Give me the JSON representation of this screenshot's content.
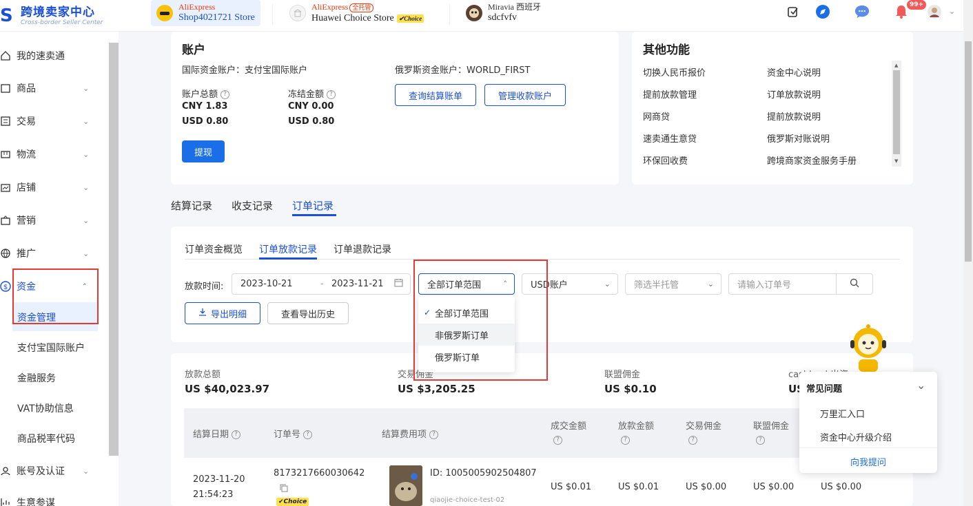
{
  "header": {
    "brand_title": "跨境卖家中心",
    "brand_sub": "Cross-border Seller Center",
    "stores": [
      {
        "platform": "AliExpress",
        "tag": "",
        "shop": "Shop4021721 Store"
      },
      {
        "platform": "AliExpress",
        "tag": "全托管",
        "shop": "Huawei Choice Store",
        "badge": "Choice"
      },
      {
        "platform": "Miravia 西班牙",
        "tag": "",
        "shop": "sdcfvfv"
      }
    ],
    "notification_count": "99+"
  },
  "sidebar": {
    "items": [
      {
        "label": "我的速卖通",
        "icon": "home-icon"
      },
      {
        "label": "商品",
        "icon": "product-icon"
      },
      {
        "label": "交易",
        "icon": "trade-icon"
      },
      {
        "label": "物流",
        "icon": "logistics-icon"
      },
      {
        "label": "店铺",
        "icon": "store-icon"
      },
      {
        "label": "营销",
        "icon": "marketing-icon"
      },
      {
        "label": "推广",
        "icon": "globe-icon"
      },
      {
        "label": "资金",
        "icon": "money-icon"
      }
    ],
    "sub_items": [
      "资金管理",
      "支付宝国际账户",
      "金融服务",
      "VAT协助信息",
      "商品税率代码"
    ],
    "bottom_items": [
      "账号及认证",
      "生意参谋"
    ]
  },
  "account": {
    "title": "账户",
    "intl_account": "国际资金账户：支付宝国际账户",
    "ru_account": "俄罗斯资金账户：WORLD_FIRST",
    "total_label": "账户总额",
    "frozen_label": "冻结金额",
    "total_cny": "CNY 1.83",
    "total_usd": "USD 0.80",
    "frozen_cny": "CNY 0.00",
    "frozen_usd": "USD 0.80",
    "btn_query": "查询结算账单",
    "btn_manage": "管理收款账户",
    "btn_withdraw": "提现"
  },
  "other": {
    "title": "其他功能",
    "left": [
      "切换人民币报价",
      "提前放款管理",
      "网商贷",
      "速卖通生意贷",
      "环保回收费"
    ],
    "right": [
      "资金中心说明",
      "订单放款说明",
      "提前放款说明",
      "俄罗斯对账说明",
      "跨境商家资金服务手册"
    ]
  },
  "tabs": [
    "结算记录",
    "收支记录",
    "订单记录"
  ],
  "subtabs": [
    "订单资金概览",
    "订单放款记录",
    "订单退款记录"
  ],
  "filters": {
    "date_label": "放款时间:",
    "date_start": "2023-10-21",
    "date_sep": "-",
    "date_end": "2023-11-21",
    "scope": "全部订单范围",
    "account": "USD账户",
    "semi": "筛选半托管",
    "order_placeholder": "请输入订单号",
    "btn_export": "导出明细",
    "btn_history": "查看导出历史"
  },
  "dropdown": {
    "options": [
      "全部订单范围",
      "非俄罗斯订单",
      "俄罗斯订单"
    ]
  },
  "stats": [
    {
      "label": "放款总额",
      "value": "US $40,023.97"
    },
    {
      "label": "交易佣金",
      "value": "US $3,205.25"
    },
    {
      "label": "联盟佣金",
      "value": "US $0.10"
    },
    {
      "label": "cashback出资",
      "value": "US"
    }
  ],
  "table": {
    "headers": [
      "结算日期",
      "订单号",
      "结算费用项",
      "成交金额",
      "放款金额",
      "交易佣金",
      "联盟佣金"
    ],
    "row": {
      "date": "2023-11-20",
      "time": "21:54:23",
      "order": "8173217660030642",
      "badge": "Choice",
      "product_id": "ID: 1005005902504807",
      "product_name": "qiaojie-choice-test-02",
      "amount": "US $0.01",
      "release": "US $0.01",
      "commission": "US $0.00",
      "alliance": "US $0.00",
      "extra": "US $0.00"
    }
  },
  "faq": {
    "title": "常见问题",
    "items": [
      "万里汇入口",
      "资金中心升级介绍"
    ],
    "ask": "向我提问"
  }
}
